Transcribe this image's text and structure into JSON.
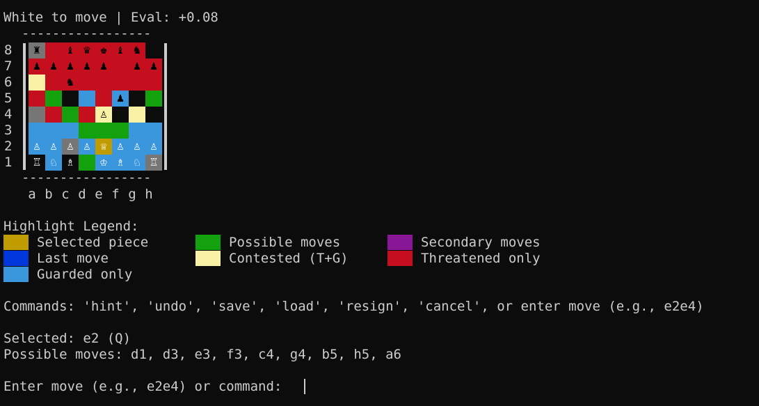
{
  "status_line": "White to move | Eval: +0.08",
  "board": {
    "border_top": "-----------------",
    "border_bottom": "-----------------",
    "ranks": [
      "8",
      "7",
      "6",
      "5",
      "4",
      "3",
      "2",
      "1"
    ],
    "files": [
      "a",
      "b",
      "c",
      "d",
      "e",
      "f",
      "g",
      "h"
    ],
    "colors": {
      "R": "#c50f1f",
      "G": "#13a10e",
      "L": "#3a96dd",
      "Y": "#f9f1a5",
      "S": "#c19c00",
      "K": "#0c0c0c",
      "D": "#767676",
      "B": "#0037da",
      "P": "#881798"
    },
    "squares": [
      [
        {
          "c": "D",
          "p": "♜",
          "s": "b"
        },
        {
          "c": "R",
          "p": "",
          "s": ""
        },
        {
          "c": "R",
          "p": "♝",
          "s": "b"
        },
        {
          "c": "R",
          "p": "♛",
          "s": "b"
        },
        {
          "c": "R",
          "p": "♚",
          "s": "b"
        },
        {
          "c": "R",
          "p": "♝",
          "s": "b"
        },
        {
          "c": "R",
          "p": "♞",
          "s": "b"
        },
        {
          "c": "K",
          "p": "",
          "s": ""
        }
      ],
      [
        {
          "c": "R",
          "p": "♟",
          "s": "b"
        },
        {
          "c": "R",
          "p": "♟",
          "s": "b"
        },
        {
          "c": "R",
          "p": "♟",
          "s": "b"
        },
        {
          "c": "R",
          "p": "♟",
          "s": "b"
        },
        {
          "c": "R",
          "p": "♟",
          "s": "b"
        },
        {
          "c": "R",
          "p": "",
          "s": ""
        },
        {
          "c": "R",
          "p": "♟",
          "s": "b"
        },
        {
          "c": "R",
          "p": "♟",
          "s": "b"
        }
      ],
      [
        {
          "c": "Y",
          "p": "",
          "s": ""
        },
        {
          "c": "R",
          "p": "",
          "s": ""
        },
        {
          "c": "R",
          "p": "♞",
          "s": "b"
        },
        {
          "c": "R",
          "p": "",
          "s": ""
        },
        {
          "c": "R",
          "p": "",
          "s": ""
        },
        {
          "c": "R",
          "p": "",
          "s": ""
        },
        {
          "c": "R",
          "p": "",
          "s": ""
        },
        {
          "c": "R",
          "p": "",
          "s": ""
        }
      ],
      [
        {
          "c": "R",
          "p": "",
          "s": ""
        },
        {
          "c": "G",
          "p": "",
          "s": ""
        },
        {
          "c": "K",
          "p": "",
          "s": ""
        },
        {
          "c": "L",
          "p": "",
          "s": ""
        },
        {
          "c": "R",
          "p": "",
          "s": ""
        },
        {
          "c": "L",
          "p": "♟",
          "s": "b"
        },
        {
          "c": "K",
          "p": "",
          "s": ""
        },
        {
          "c": "G",
          "p": "",
          "s": ""
        }
      ],
      [
        {
          "c": "D",
          "p": "",
          "s": ""
        },
        {
          "c": "R",
          "p": "",
          "s": ""
        },
        {
          "c": "G",
          "p": "",
          "s": ""
        },
        {
          "c": "R",
          "p": "",
          "s": ""
        },
        {
          "c": "Y",
          "p": "♙",
          "s": "b"
        },
        {
          "c": "K",
          "p": "",
          "s": ""
        },
        {
          "c": "Y",
          "p": "",
          "s": ""
        },
        {
          "c": "K",
          "p": "",
          "s": ""
        }
      ],
      [
        {
          "c": "L",
          "p": "",
          "s": ""
        },
        {
          "c": "L",
          "p": "",
          "s": ""
        },
        {
          "c": "L",
          "p": "",
          "s": ""
        },
        {
          "c": "G",
          "p": "",
          "s": ""
        },
        {
          "c": "G",
          "p": "",
          "s": ""
        },
        {
          "c": "G",
          "p": "",
          "s": ""
        },
        {
          "c": "L",
          "p": "",
          "s": ""
        },
        {
          "c": "L",
          "p": "",
          "s": ""
        }
      ],
      [
        {
          "c": "L",
          "p": "♙",
          "s": "w"
        },
        {
          "c": "L",
          "p": "♙",
          "s": "w"
        },
        {
          "c": "D",
          "p": "♙",
          "s": "w"
        },
        {
          "c": "L",
          "p": "♙",
          "s": "w"
        },
        {
          "c": "S",
          "p": "♕",
          "s": "w"
        },
        {
          "c": "L",
          "p": "♙",
          "s": "w"
        },
        {
          "c": "L",
          "p": "♙",
          "s": "w"
        },
        {
          "c": "L",
          "p": "♙",
          "s": "w"
        }
      ],
      [
        {
          "c": "K",
          "p": "♖",
          "s": "w"
        },
        {
          "c": "L",
          "p": "♘",
          "s": "w"
        },
        {
          "c": "K",
          "p": "♗",
          "s": "w"
        },
        {
          "c": "G",
          "p": "",
          "s": ""
        },
        {
          "c": "L",
          "p": "♔",
          "s": "w"
        },
        {
          "c": "L",
          "p": "♗",
          "s": "w"
        },
        {
          "c": "L",
          "p": "♘",
          "s": "w"
        },
        {
          "c": "D",
          "p": "♖",
          "s": "w"
        }
      ]
    ]
  },
  "legend": {
    "title": "Highlight Legend:",
    "items": [
      {
        "label": "Selected piece",
        "color": "#c19c00"
      },
      {
        "label": "Last move",
        "color": "#0037da"
      },
      {
        "label": "Guarded only",
        "color": "#3a96dd"
      },
      {
        "label": "Possible moves",
        "color": "#13a10e"
      },
      {
        "label": "Contested (T+G)",
        "color": "#f9f1a5"
      },
      {
        "label": "Secondary moves",
        "color": "#881798"
      },
      {
        "label": "Threatened only",
        "color": "#c50f1f"
      }
    ]
  },
  "commands_line": "Commands: 'hint', 'undo', 'save', 'load', 'resign', 'cancel', or enter move (e.g., e2e4)",
  "selected_line": "Selected: e2 (Q)",
  "possible_moves_line": "Possible moves: d1, d3, e3, f3, c4, g4, b5, h5, a6",
  "prompt": "Enter move (e.g., e2e4) or command: "
}
